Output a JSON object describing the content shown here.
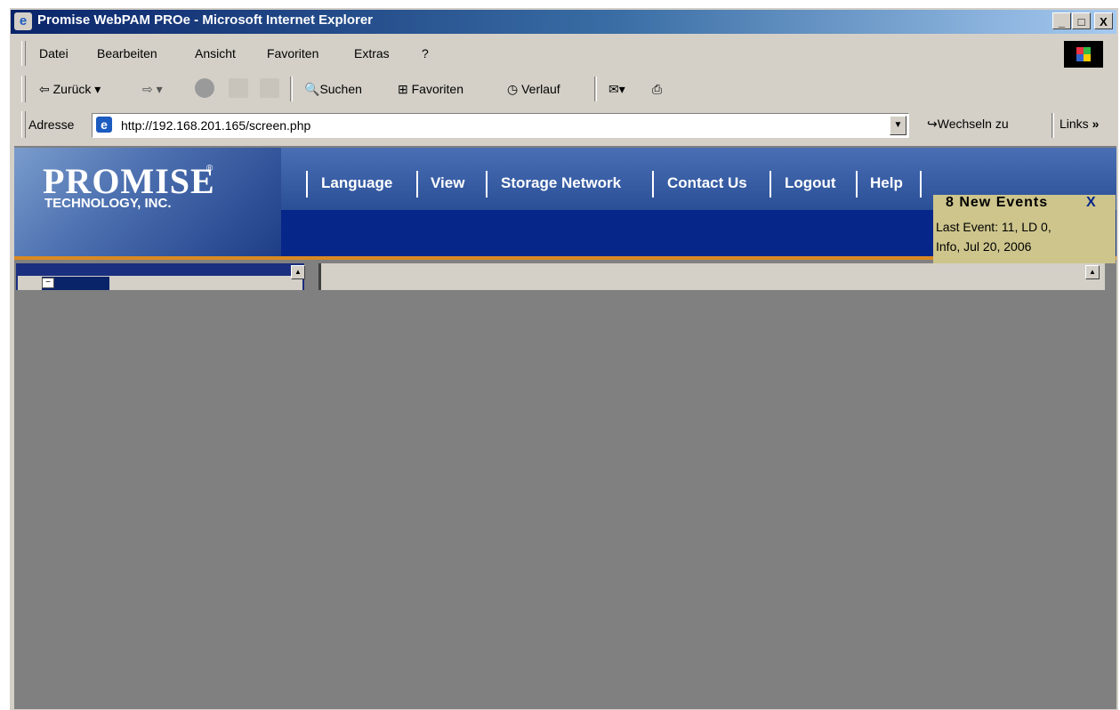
{
  "window": {
    "title": "Promise WebPAM PROe - Microsoft Internet Explorer",
    "controls": {
      "minimize": "_",
      "maximize": "□",
      "close": "X"
    }
  },
  "menu": {
    "items": [
      "Datei",
      "Bearbeiten",
      "Ansicht",
      "Favoriten",
      "Extras",
      "?"
    ]
  },
  "toolbar": {
    "back_label": "Zurück",
    "search_label": "Suchen",
    "favorites_label": "Favoriten",
    "history_label": "Verlauf"
  },
  "address_bar": {
    "label": "Adresse",
    "url": "http://192.168.201.165/screen.php",
    "go_label": "Wechseln zu",
    "links_label": "Links",
    "links_chevron": "»"
  },
  "page": {
    "logo": {
      "line1": "PROMISE",
      "registered": "®",
      "line2": "TECHNOLOGY, INC."
    },
    "nav_items": [
      "Language",
      "View",
      "Storage Network",
      "Contact Us",
      "Logout",
      "Help"
    ],
    "event_popup": {
      "title": "8 New Events",
      "close": "X",
      "line1": "Last Event: 11, LD 0,",
      "line2": "Info, Jul 20, 2006"
    }
  },
  "colors": {
    "banner": "#2a4f96",
    "banner_dark": "#06268a",
    "accent_orange": "#d98a22",
    "event_popup_bg": "#cdc58c",
    "overlay_gray": "#808080"
  }
}
